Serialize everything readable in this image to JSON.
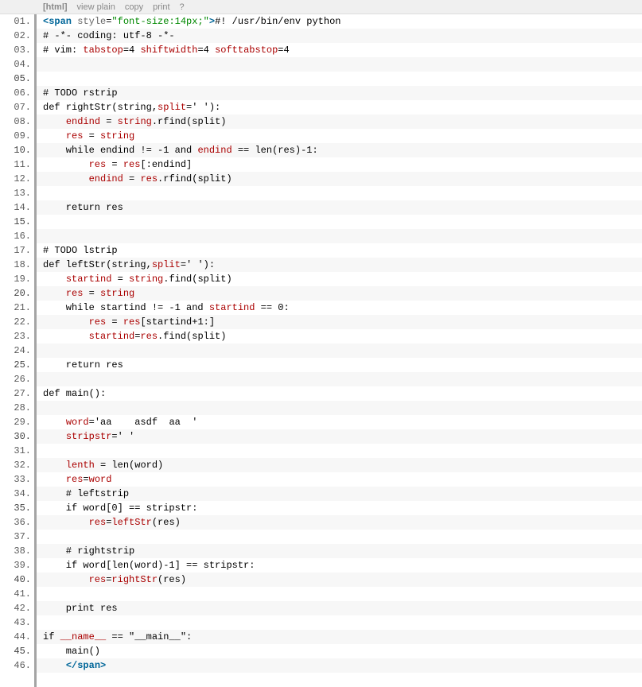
{
  "toolbar": {
    "lang": "[html]",
    "view_plain": "view plain",
    "copy": "copy",
    "print": "print",
    "help": "?"
  },
  "gutter": {
    "numbers": [
      "01.",
      "02.",
      "03.",
      "04.",
      "05.",
      "06.",
      "07.",
      "08.",
      "09.",
      "10.",
      "11.",
      "12.",
      "13.",
      "14.",
      "15.",
      "16.",
      "17.",
      "18.",
      "19.",
      "20.",
      "21.",
      "22.",
      "23.",
      "24.",
      "25.",
      "26.",
      "27.",
      "28.",
      "29.",
      "30.",
      "31.",
      "32.",
      "33.",
      "34.",
      "35.",
      "36.",
      "37.",
      "38.",
      "39.",
      "40.",
      "41.",
      "42.",
      "43.",
      "44.",
      "45.",
      "46."
    ]
  },
  "code": {
    "l1": {
      "open": "<",
      "tag": "span",
      "sp": " ",
      "attr": "style",
      "eq": "=",
      "str": "\"font-size:14px;\"",
      "close": ">",
      "txt": "#! /usr/bin/env python  "
    },
    "l2": {
      "txt": "# -*- coding: utf-8 -*-  "
    },
    "l3": {
      "a": "# vim: ",
      "b": "tabstop",
      "c": "=4 ",
      "d": "shiftwidth",
      "e": "=4 ",
      "f": "softtabstop",
      "g": "=4  "
    },
    "l4": {
      "txt": "  "
    },
    "l5": {
      "txt": "  "
    },
    "l6": {
      "txt": "# TODO rstrip  "
    },
    "l7": {
      "a": "def rightStr(string,",
      "b": "split",
      "c": "=' '):  "
    },
    "l8": {
      "a": "    ",
      "b": "endind",
      "c": " = ",
      "d": "string",
      "e": ".rfind(split)  "
    },
    "l9": {
      "a": "    ",
      "b": "res",
      "c": " = ",
      "d": "string",
      "e": "  "
    },
    "l10": {
      "a": "    while endind != -1 and ",
      "b": "endind",
      "c": " == len(res)-1:  "
    },
    "l11": {
      "a": "        ",
      "b": "res",
      "c": " = ",
      "d": "res",
      "e": "[:endind]  "
    },
    "l12": {
      "a": "        ",
      "b": "endind",
      "c": " = ",
      "d": "res",
      "e": ".rfind(split)  "
    },
    "l13": {
      "txt": "  "
    },
    "l14": {
      "txt": "    return res  "
    },
    "l15": {
      "txt": "  "
    },
    "l16": {
      "txt": "  "
    },
    "l17": {
      "txt": "# TODO lstrip  "
    },
    "l18": {
      "a": "def leftStr(string,",
      "b": "split",
      "c": "=' '):  "
    },
    "l19": {
      "a": "    ",
      "b": "startind",
      "c": " = ",
      "d": "string",
      "e": ".find(split)  "
    },
    "l20": {
      "a": "    ",
      "b": "res",
      "c": " = ",
      "d": "string",
      "e": "  "
    },
    "l21": {
      "a": "    while startind != -1 and ",
      "b": "startind",
      "c": " == 0:  "
    },
    "l22": {
      "a": "        ",
      "b": "res",
      "c": " = ",
      "d": "res",
      "e": "[startind+1:]  "
    },
    "l23": {
      "a": "        ",
      "b": "startind",
      "c": "=",
      "d": "res",
      "e": ".find(split)  "
    },
    "l24": {
      "txt": "  "
    },
    "l25": {
      "txt": "    return res  "
    },
    "l26": {
      "txt": "  "
    },
    "l27": {
      "txt": "def main():  "
    },
    "l28": {
      "txt": "  "
    },
    "l29": {
      "a": "    ",
      "b": "word",
      "c": "='aa    asdf  aa  '  "
    },
    "l30": {
      "a": "    ",
      "b": "stripstr",
      "c": "=' '  "
    },
    "l31": {
      "txt": "  "
    },
    "l32": {
      "a": "    ",
      "b": "lenth",
      "c": " = len(word)  "
    },
    "l33": {
      "a": "    ",
      "b": "res",
      "c": "=",
      "d": "word",
      "e": "  "
    },
    "l34": {
      "txt": "    # leftstrip  "
    },
    "l35": {
      "txt": "    if word[0] == stripstr:  "
    },
    "l36": {
      "a": "        ",
      "b": "res",
      "c": "=",
      "d": "leftStr",
      "e": "(res)  "
    },
    "l37": {
      "txt": "  "
    },
    "l38": {
      "txt": "    # rightstrip  "
    },
    "l39": {
      "txt": "    if word[len(word)-1] == stripstr:  "
    },
    "l40": {
      "a": "        ",
      "b": "res",
      "c": "=",
      "d": "rightStr",
      "e": "(res)  "
    },
    "l41": {
      "txt": "  "
    },
    "l42": {
      "txt": "    print res  "
    },
    "l43": {
      "txt": "  "
    },
    "l44": {
      "a": "if ",
      "b": "__name__",
      "c": " == \"__main__\":  "
    },
    "l45": {
      "txt": "    main()  "
    },
    "l46": {
      "a": "    ",
      "open": "</",
      "tag": "span",
      "close": ">",
      "txt": "  "
    }
  }
}
